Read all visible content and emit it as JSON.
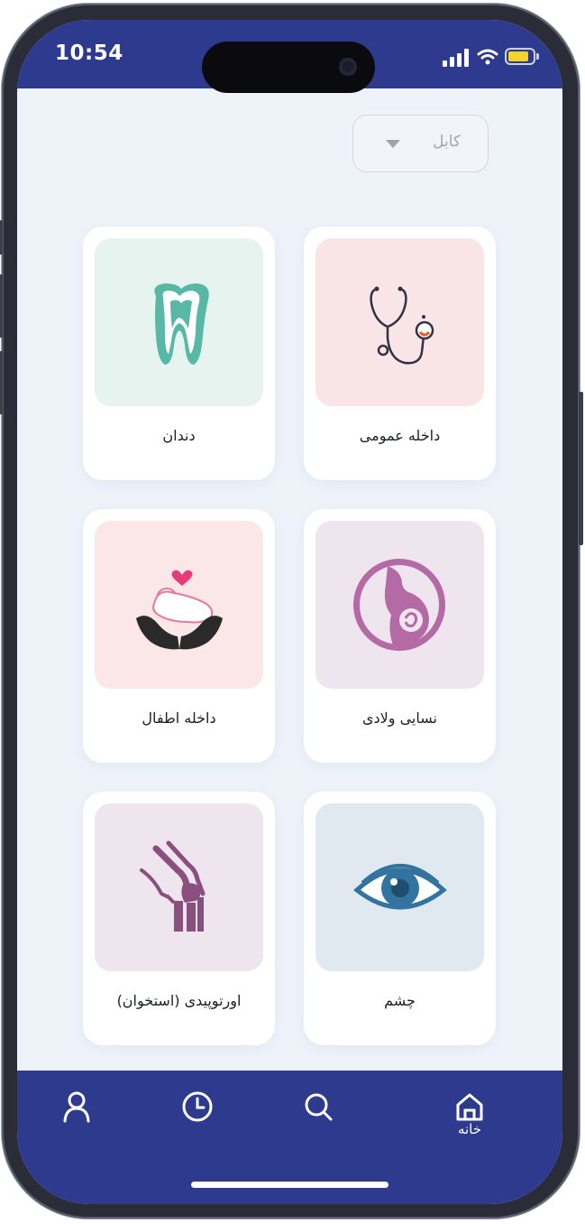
{
  "status_bar": {
    "time": "10:54"
  },
  "city_dropdown": {
    "selected": "کابل",
    "icon": "chevron-down-icon"
  },
  "specialties": [
    {
      "label": "داخله عمومی",
      "icon": "stethoscope-icon",
      "bg": "#f9e4e6"
    },
    {
      "label": "دندان",
      "icon": "tooth-icon",
      "bg": "#e6f3ef"
    },
    {
      "label": "نسایی ولادی",
      "icon": "pregnancy-icon",
      "bg": "#efe5ee"
    },
    {
      "label": "داخله اطفال",
      "icon": "baby-in-hands-icon",
      "bg": "#fbe6e8"
    },
    {
      "label": "چشم",
      "icon": "eye-icon",
      "bg": "#e1e9f0"
    },
    {
      "label": "اورتوپیدی (استخوان)",
      "icon": "knee-joint-icon",
      "bg": "#efe5ee"
    }
  ],
  "bottom_nav": {
    "items": [
      {
        "label": "خانه",
        "icon": "home-icon",
        "active": true
      },
      {
        "label": "",
        "icon": "search-icon"
      },
      {
        "label": "",
        "icon": "clock-icon"
      },
      {
        "label": "",
        "icon": "user-icon"
      }
    ]
  },
  "colors": {
    "brand": "#2e3a8e",
    "background": "#eef3fa",
    "battery": "#f6d22a"
  }
}
